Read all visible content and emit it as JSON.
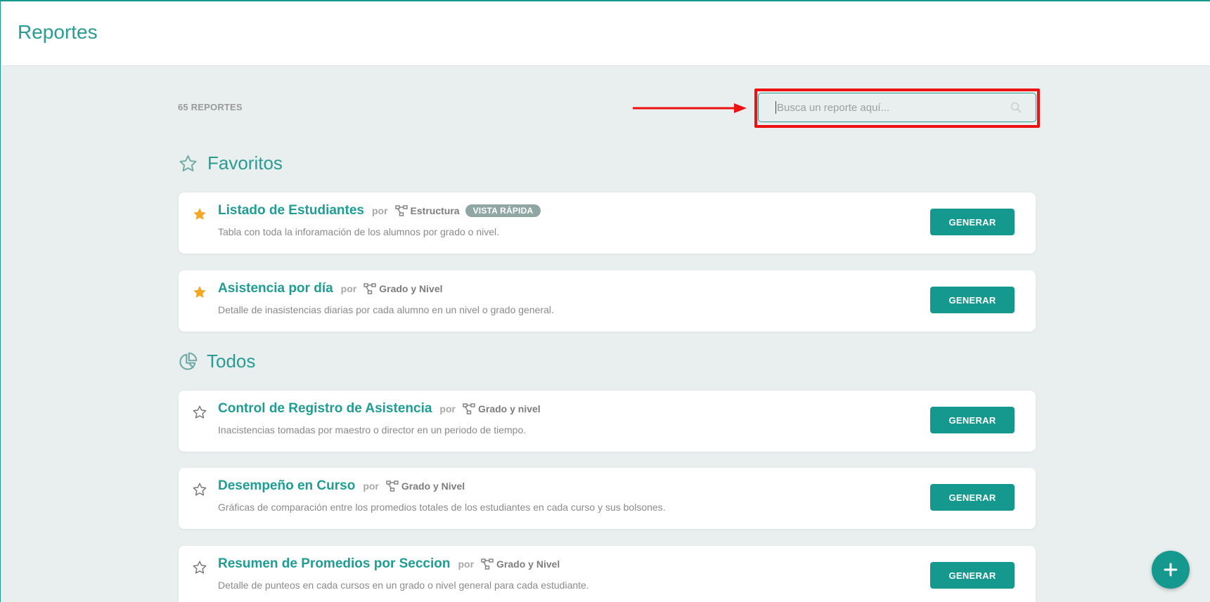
{
  "header": {
    "title": "Reportes"
  },
  "toolbar": {
    "count_label": "65 REPORTES",
    "search_placeholder": "Busca un reporte aquí..."
  },
  "sections": {
    "favorites": {
      "title": "Favoritos",
      "icon": "star-outline-icon"
    },
    "all": {
      "title": "Todos",
      "icon": "pie-chart-icon"
    }
  },
  "reports": [
    {
      "title": "Listado de Estudiantes",
      "por": "por",
      "scope": "Estructura",
      "badge": "VISTA RÁPIDA",
      "description": "Tabla con toda la inforamación de los alumnos por grado o nivel.",
      "favorite": true,
      "button": "GENERAR"
    },
    {
      "title": "Asistencia por día",
      "por": "por",
      "scope": "Grado y Nivel",
      "description": "Detalle de inasistencias diarias por cada alumno en un nivel o grado general.",
      "favorite": true,
      "button": "GENERAR"
    },
    {
      "title": "Control de Registro de Asistencia",
      "por": "por",
      "scope": "Grado y nivel",
      "description": "Inacistencias tomadas por maestro o director en un periodo de tiempo.",
      "favorite": false,
      "button": "GENERAR"
    },
    {
      "title": "Desempeño en Curso",
      "por": "por",
      "scope": "Grado y Nivel",
      "description": "Gráficas de comparación entre los promedios totales de los estudiantes en cada curso y sus bolsones.",
      "favorite": false,
      "button": "GENERAR"
    },
    {
      "title": "Resumen de Promedios por Seccion",
      "por": "por",
      "scope": "Grado y Nivel",
      "description": "Detalle de punteos en cada cursos en un grado o nivel general para cada estudiante.",
      "favorite": false,
      "button": "GENERAR"
    }
  ],
  "colors": {
    "accent": "#15998f",
    "title": "#2a9c92",
    "favorite_star": "#f5a623",
    "highlight": "#ee1111",
    "background": "#e9eeee"
  }
}
